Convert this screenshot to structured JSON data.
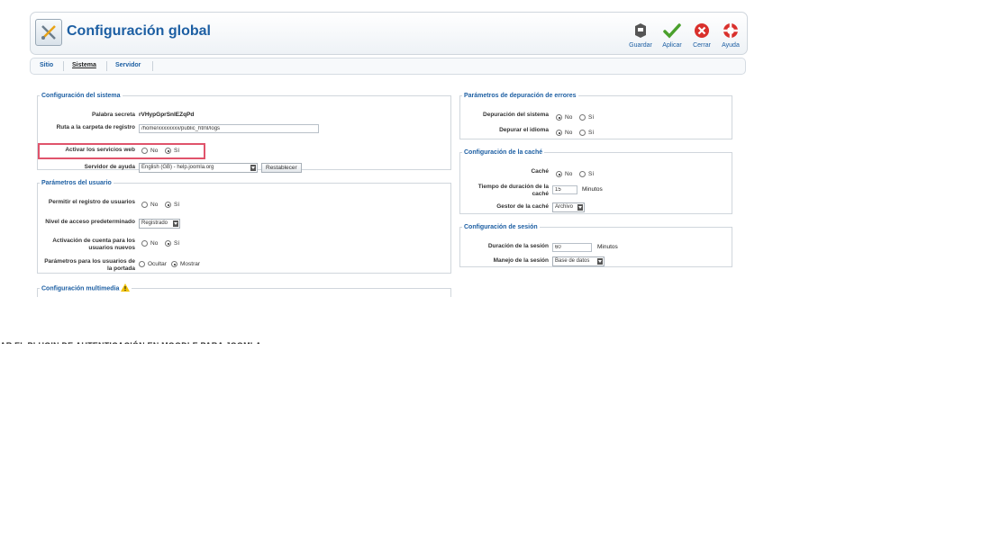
{
  "header": {
    "title": "Configuración global"
  },
  "toolbar": [
    {
      "label": "Guardar",
      "icon": "save-icon"
    },
    {
      "label": "Aplicar",
      "icon": "checkmark-icon"
    },
    {
      "label": "Cerrar",
      "icon": "close-icon"
    },
    {
      "label": "Ayuda",
      "icon": "help-lifebuoy-icon"
    }
  ],
  "tabs": [
    "Sitio",
    "Sistema",
    "Servidor"
  ],
  "active_tab": "Sistema",
  "system": {
    "legend": "Configuración del sistema",
    "secret_label": "Palabra secreta",
    "secret_value": "rVHypGprSnlEZqPd",
    "log_label": "Ruta a la carpeta de registro",
    "log_value": "/home/xxxxxxxx/public_html/logs",
    "webservices_label": "Activar los servicios web",
    "help_label": "Servidor de ayuda",
    "help_value": "English (GB) - help.joomla.org",
    "reset_label": "Restablecer"
  },
  "users": {
    "legend": "Parámetros del usuario",
    "allow_reg_label": "Permitir el registro de usuarios",
    "access_label": "Nivel de acceso predeterminado",
    "access_value": "Registrado",
    "activation_label": "Activación de cuenta para los usuarios nuevos",
    "frontend_label": "Parámetros para los usuarios de la portada",
    "hide": "Ocultar",
    "show": "Mostrar"
  },
  "media": {
    "legend": "Configuración multimedia"
  },
  "debug": {
    "legend": "Parámetros de depuración de errores",
    "sys_label": "Depuración del sistema",
    "lang_label": "Depurar el idioma"
  },
  "cache": {
    "legend": "Configuración de la caché",
    "cache_label": "Caché",
    "time_label": "Tiempo de duración de la caché",
    "time_value": "15",
    "time_unit": "Minutos",
    "handler_label": "Gestor de la caché",
    "handler_value": "Archivo"
  },
  "session": {
    "legend": "Configuración de sesión",
    "lifetime_label": "Duración de la sesión",
    "lifetime_value": "60",
    "lifetime_unit": "Minutos",
    "handler_label": "Manejo de la sesión",
    "handler_value": "Base de datos"
  },
  "common": {
    "no": "No",
    "yes": "Sí"
  },
  "caption": "AR EL PLUGIN DE AUTENTICACIÓN EN MOODLE PARA JOOMLA",
  "colors": {
    "accent": "#1d5fa3",
    "highlight": "#e0536b"
  }
}
